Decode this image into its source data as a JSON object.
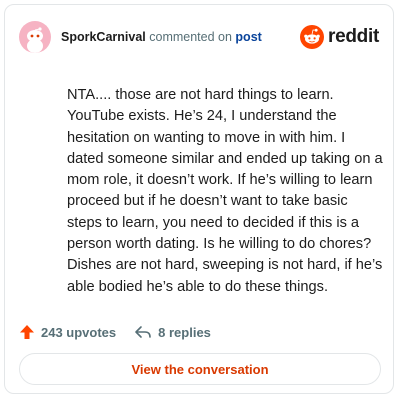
{
  "header": {
    "username": "SporkCarnival",
    "action_text": "commented on",
    "post_link": "post",
    "brand_name": "reddit",
    "avatar_icon": "snoo-avatar-icon",
    "brand_icon": "reddit-logo-icon"
  },
  "comment": {
    "text": "NTA.... those are not hard things to learn. YouTube exists. He’s 24, I understand the hesitation on wanting to move in with him. I dated someone similar and ended up taking on a mom role, it doesn’t work. If he’s willing to learn proceed but if he doesn’t want to take basic steps to learn, you need to decided if this is a person worth dating. Is he willing to do chores? Dishes are not hard, sweeping is not hard, if he’s able bodied he’s able to do these things."
  },
  "footer": {
    "upvotes": "243 upvotes",
    "replies": "8 replies",
    "upvote_icon": "upvote-arrow-icon",
    "reply_icon": "reply-arrow-icon"
  },
  "cta": {
    "label": "View the conversation"
  },
  "colors": {
    "accent": "#d93900",
    "reddit_orange": "#ff4500",
    "link": "#0a449b",
    "avatar_bg": "#f6b3c3"
  }
}
